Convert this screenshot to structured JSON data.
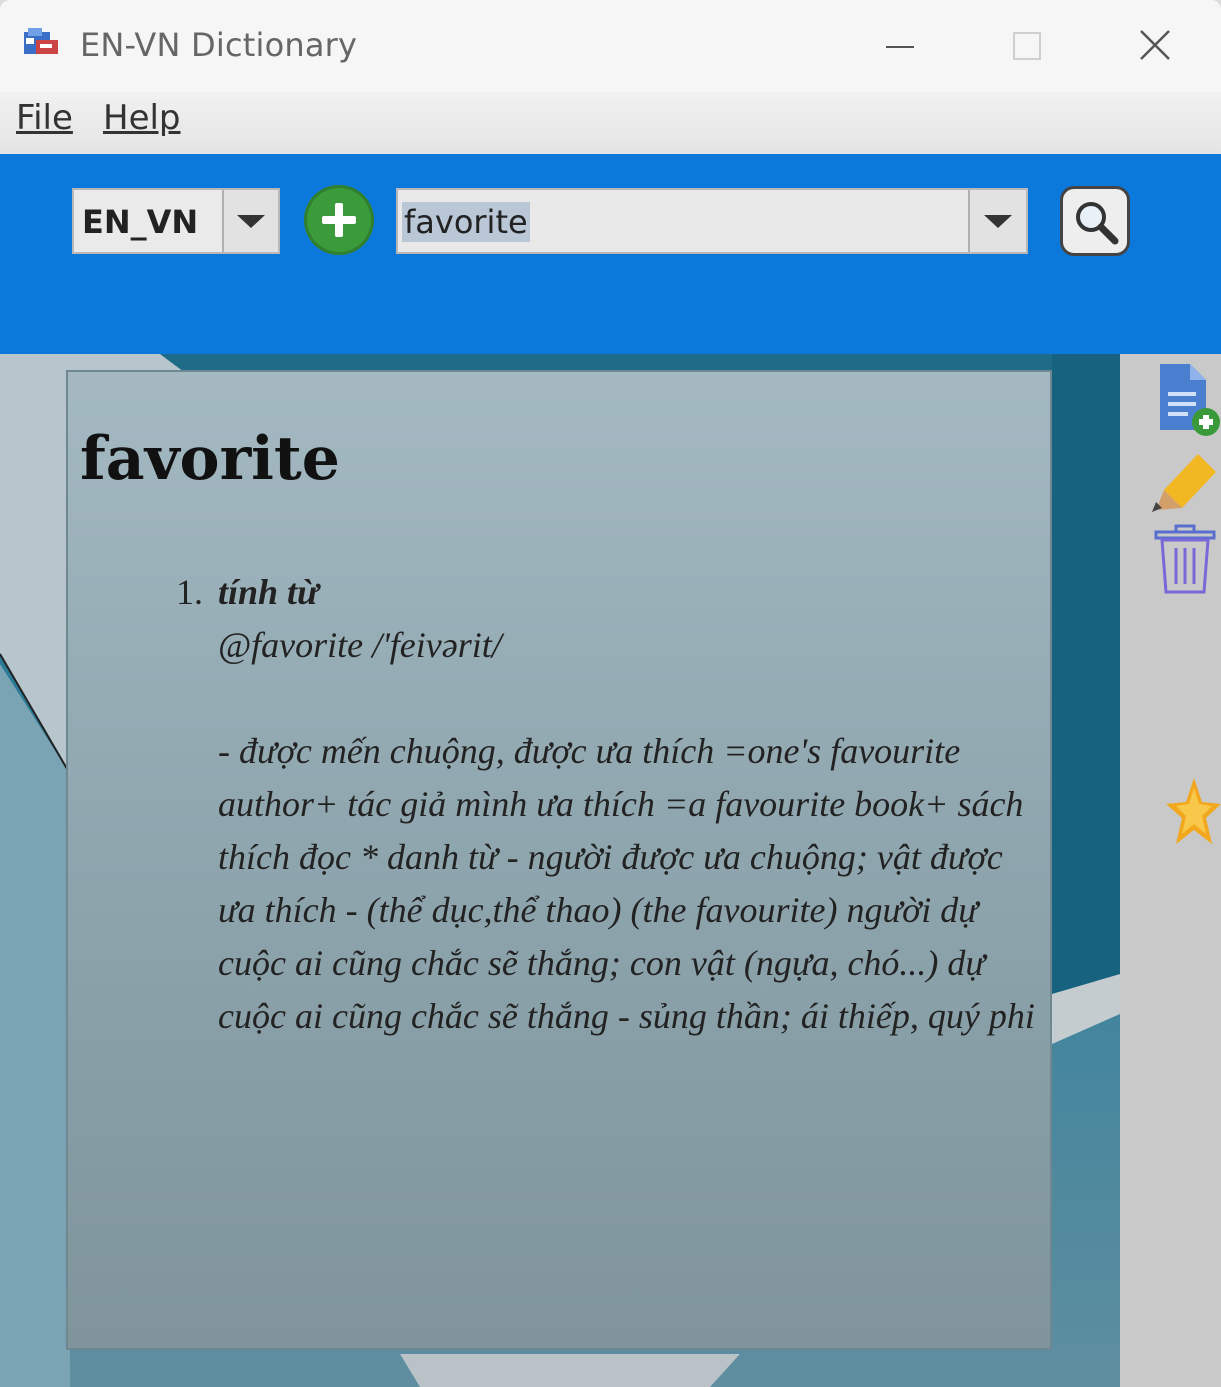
{
  "window": {
    "title": "EN-VN Dictionary"
  },
  "menu": {
    "file": "File",
    "help": "Help"
  },
  "toolbar": {
    "language": "EN_VN",
    "search_value": "favorite"
  },
  "entry": {
    "word": "favorite",
    "number": "1.",
    "part_of_speech": "tính từ",
    "pronunciation": "@favorite /'feivərit/",
    "definition": "- được mến chuộng, được ưa thích =one's favourite author+ tác giả mình ưa thích =a favourite book+ sách thích đọc * danh từ - người được ưa chuộng; vật được ưa thích - (thể dục,thể thao) (the favourite) người dự cuộc ai cũng chắc sẽ thắng; con vật (ngựa, chó...) dự cuộc ai cũng chắc sẽ thắng - sủng thần; ái thiếp, quý phi"
  },
  "icons": {
    "app": "dictionary-app-icon",
    "minimize": "minimize-icon",
    "maximize": "maximize-icon",
    "close": "close-icon",
    "add": "plus-icon",
    "search": "magnifier-icon",
    "add_document": "add-document-icon",
    "edit": "pencil-icon",
    "delete": "trash-icon",
    "favorite": "star-icon"
  },
  "colors": {
    "toolbar_blue": "#0b78dc",
    "add_green": "#3b9b3b"
  }
}
